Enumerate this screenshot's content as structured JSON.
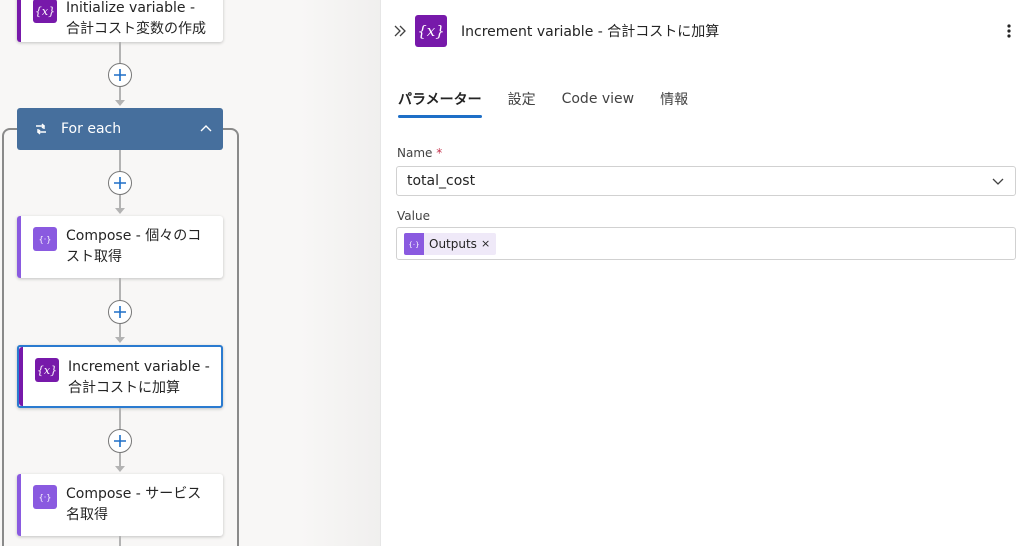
{
  "canvas": {
    "cards": [
      {
        "id": "init-var",
        "label": "Initialize variable - 合計コスト変数の作成",
        "icon": "variable-icon",
        "accent": "#7719aa"
      },
      {
        "id": "compose-cost",
        "label": "Compose - 個々のコスト取得",
        "icon": "compose-icon",
        "accent": "#8a5ae0"
      },
      {
        "id": "increment-var",
        "label": "Increment variable - 合計コストに加算",
        "icon": "variable-icon",
        "accent": "#7719aa",
        "selected": true
      },
      {
        "id": "compose-service",
        "label": "Compose - サービス名取得",
        "icon": "compose-icon",
        "accent": "#8a5ae0"
      }
    ],
    "foreach": {
      "title": "For each"
    }
  },
  "panel": {
    "title": "Increment variable - 合計コストに加算",
    "tabs": [
      {
        "label": "パラメーター",
        "active": true
      },
      {
        "label": "設定",
        "active": false
      },
      {
        "label": "Code view",
        "active": false
      },
      {
        "label": "情報",
        "active": false
      }
    ],
    "name_field": {
      "label": "Name",
      "required_mark": "*",
      "value": "total_cost"
    },
    "value_field": {
      "label": "Value",
      "token_label": "Outputs",
      "token_remove": "×"
    }
  },
  "colors": {
    "variable_purple": "#7719aa",
    "compose_purple": "#8a5ae0",
    "foreach_blue": "#466f9d",
    "selected_border": "#2b7bd0",
    "tab_underline": "#1e6fc7"
  }
}
